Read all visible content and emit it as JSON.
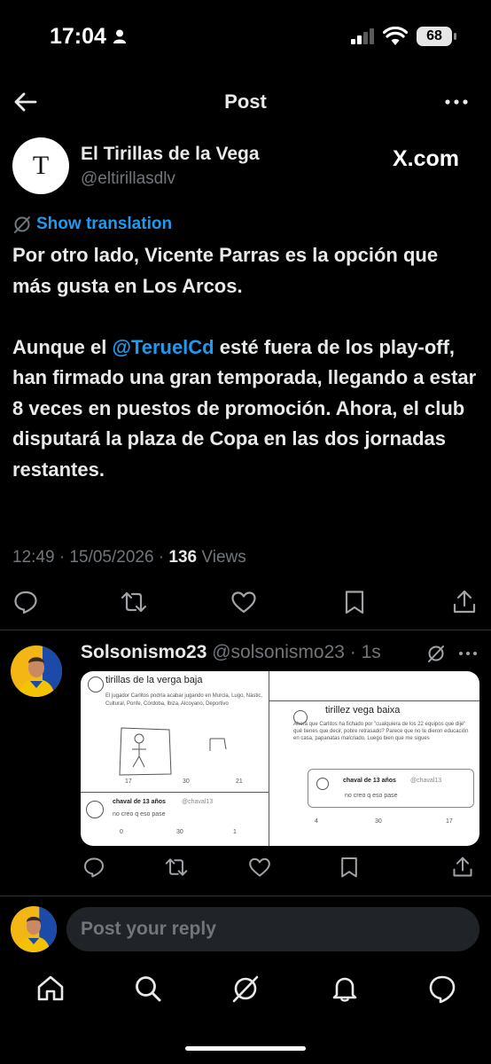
{
  "status_bar": {
    "time": "17:04",
    "battery": "68"
  },
  "header": {
    "title": "Post"
  },
  "tweet": {
    "author_name": "El Tirillas de la Vega",
    "author_handle": "@eltirillasdlv",
    "avatar_letter": "T",
    "source_label": "X.com",
    "translate_label": "Show translation",
    "paragraph1": "Por otro lado, Vicente Parras es la opción que más gusta en Los Arcos.",
    "paragraph2_before": "Aunque el ",
    "paragraph2_mention": "@TeruelCd",
    "paragraph2_after": " esté fuera de los play-off, han firmado una gran temporada, llegando a estar 8 veces en puestos de promoción. Ahora, el club disputará la plaza de Copa en las dos jornadas restantes.",
    "timestamp": "12:49 · 15/05/2026 · ",
    "views_count": "136",
    "views_label": " Views"
  },
  "reply": {
    "name": "Solsonismo23",
    "handle": "@solsonismo23",
    "time": "· 1s",
    "image": {
      "left_title": "tirillas de la verga baja",
      "left_text": "El jugador Carlitos podría acabar jugando en Murcia, Lugo, Nàstic, Cultural, Ponfe, Córdoba, Ibiza, Alcoyano, Deportivo",
      "left_stats": [
        "17",
        "30",
        "21"
      ],
      "right_title": "tirillez vega baixa",
      "right_text": "Ahora que Carlitos ha fichado por \"cualquiera de los 22 equipos que dije\" qué tienes que decir, pobre retrasado? Parece que no te dieron educación en casa, papanatas malcriado. Luego bien que me sigues",
      "inner_name": "chaval de 13 años",
      "inner_handle": "@chaval13",
      "inner_text": "no creo q eso pase",
      "right_stats": [
        "4",
        "30",
        "17"
      ],
      "bottom_name": "chaval de 13 años",
      "bottom_handle": "@chaval13",
      "bottom_text": "no creo q eso pase",
      "bottom_stats": [
        "0",
        "30",
        "1"
      ]
    }
  },
  "compose": {
    "placeholder": "Post your reply"
  },
  "colors": {
    "background": "#000000",
    "text": "#e7e9ea",
    "muted": "#71767b",
    "link": "#1d9bf0"
  }
}
